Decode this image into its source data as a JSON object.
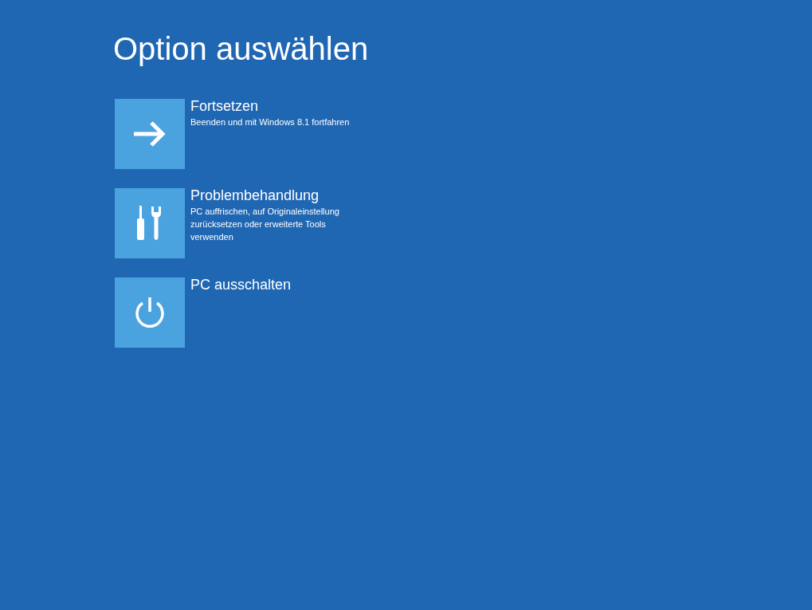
{
  "title": "Option auswählen",
  "options": [
    {
      "kind": "arrow",
      "label": "Fortsetzen",
      "description": "Beenden und mit Windows 8.1 fortfahren"
    },
    {
      "kind": "tools",
      "label": "Problembehandlung",
      "description": "PC auffrischen, auf Originaleinstellung zurücksetzen oder erweiterte Tools verwenden"
    },
    {
      "kind": "power",
      "label": "PC ausschalten"
    }
  ]
}
